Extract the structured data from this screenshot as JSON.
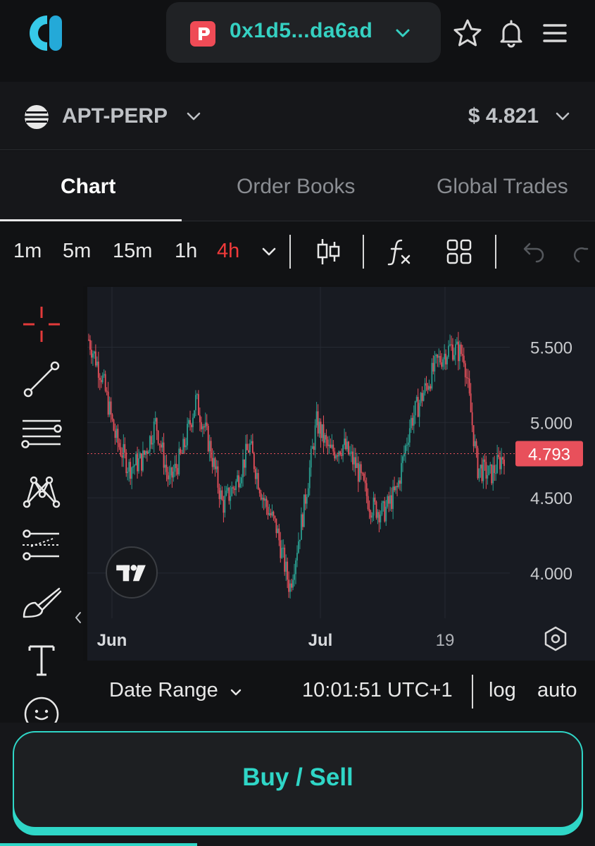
{
  "header": {
    "wallet_address": "0x1d5...da6ad"
  },
  "market": {
    "symbol": "APT-PERP",
    "price": "$ 4.821"
  },
  "tabs": [
    {
      "label": "Chart"
    },
    {
      "label": "Order Books"
    },
    {
      "label": "Global Trades"
    }
  ],
  "toolbar": {
    "timeframes": [
      "1m",
      "5m",
      "15m",
      "1h",
      "4h"
    ],
    "active_timeframe": "4h"
  },
  "infobar": {
    "date_range_label": "Date Range",
    "time": "10:01:51 UTC+1",
    "log_label": "log",
    "auto_label": "auto"
  },
  "footer": {
    "buy_sell_label": "Buy / Sell"
  },
  "colors": {
    "accent": "#2fd6c7",
    "up": "#2a9d8f",
    "down": "#e8505b",
    "price_line": "#e8505b"
  },
  "chart_data": {
    "type": "candlestick",
    "x_ticks": [
      "Jun",
      "Jul",
      "19"
    ],
    "y_ticks": [
      "5.500",
      "5.000",
      "4.500",
      "4.000"
    ],
    "y_range": [
      3.7,
      5.9
    ],
    "last_price_label": "4.793",
    "last_price": 4.793,
    "anchors": [
      5.55,
      5.3,
      4.9,
      4.7,
      4.75,
      5.0,
      4.6,
      4.8,
      5.15,
      4.85,
      4.45,
      4.6,
      4.85,
      4.5,
      4.3,
      3.9,
      4.4,
      5.0,
      4.8,
      4.85,
      4.7,
      4.45,
      4.4,
      4.55,
      5.0,
      5.2,
      5.4,
      5.5,
      5.45,
      4.7,
      4.65,
      4.79
    ]
  }
}
